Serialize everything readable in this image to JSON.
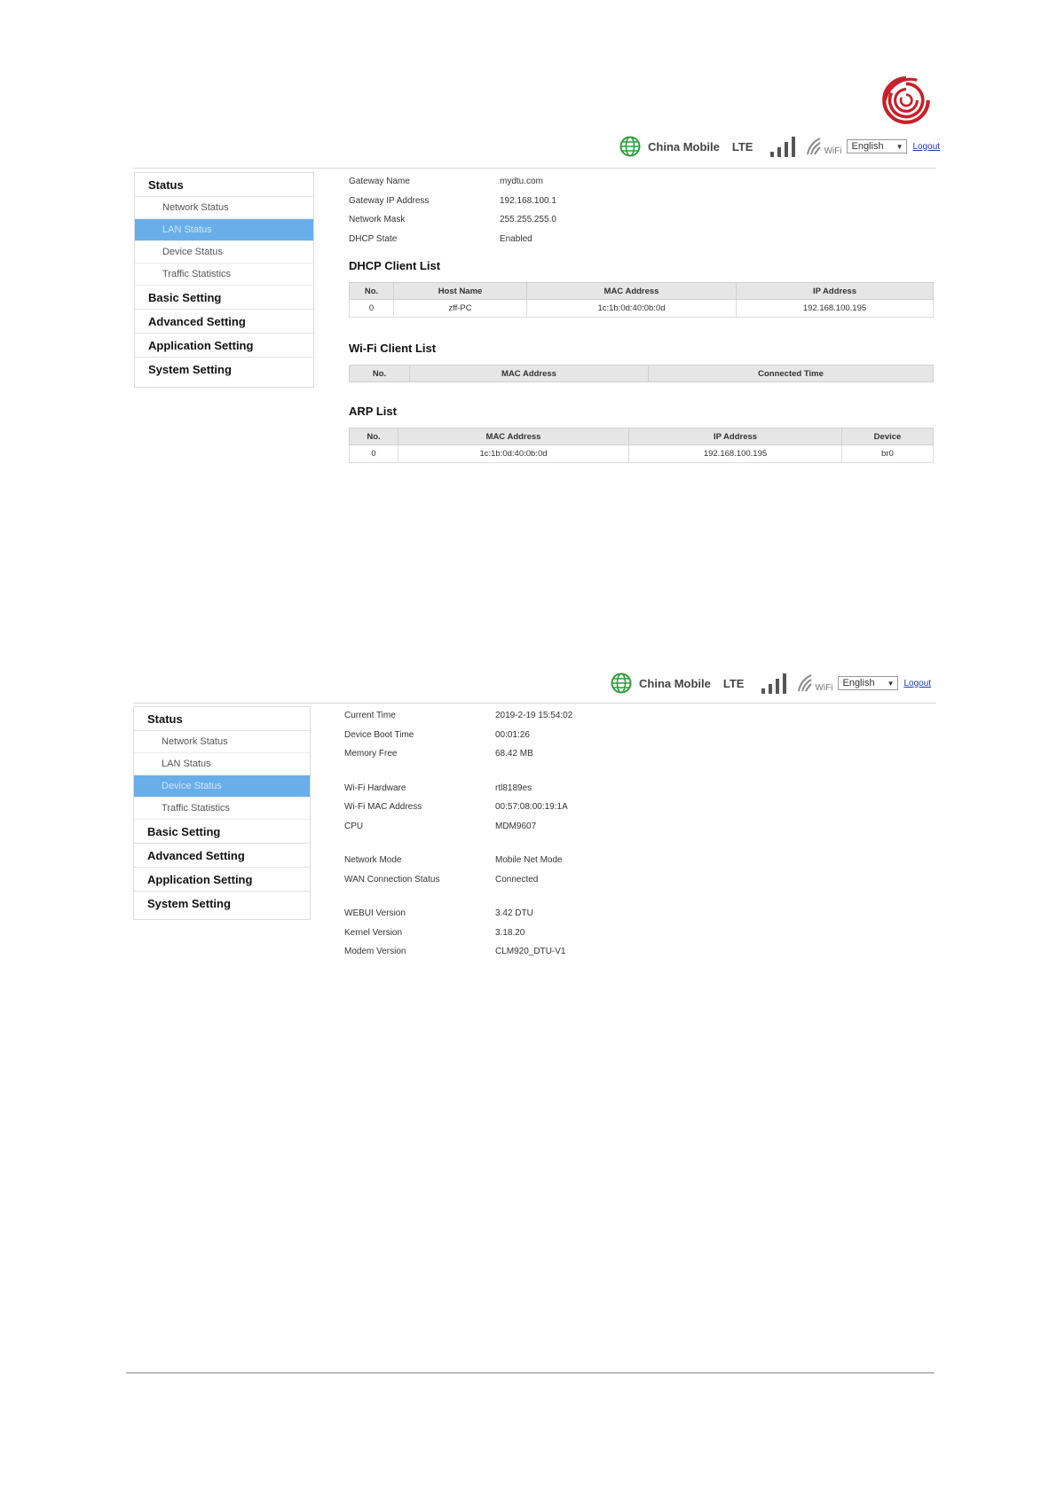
{
  "header": {
    "carrier": "China Mobile",
    "network_type": "LTE",
    "wifi_label": "WiFi",
    "language": "English",
    "logout": "Logout"
  },
  "sidebar1": {
    "status": "Status",
    "network_status": "Network Status",
    "lan_status": "LAN Status",
    "device_status": "Device Status",
    "traffic_statistics": "Traffic Statistics",
    "basic_setting": "Basic Setting",
    "advanced_setting": "Advanced Setting",
    "application_setting": "Application Setting",
    "system_setting": "System Setting",
    "active_item": "LAN Status"
  },
  "sidebar2": {
    "status": "Status",
    "network_status": "Network Status",
    "lan_status": "LAN Status",
    "device_status": "Device Status",
    "traffic_statistics": "Traffic Statistics",
    "basic_setting": "Basic Setting",
    "advanced_setting": "Advanced Setting",
    "application_setting": "Application Setting",
    "system_setting": "System Setting",
    "active_item": "Device Status"
  },
  "lan_info": {
    "gateway_name_label": "Gateway Name",
    "gateway_name": "mydtu.com",
    "gateway_ip_label": "Gateway IP Address",
    "gateway_ip": "192.168.100.1",
    "network_mask_label": "Network Mask",
    "network_mask": "255.255.255.0",
    "dhcp_state_label": "DHCP State",
    "dhcp_state": "Enabled"
  },
  "dhcp": {
    "title": "DHCP Client List",
    "headers": [
      "No.",
      "Host Name",
      "MAC Address",
      "IP Address"
    ],
    "rows": [
      [
        "0",
        "zff-PC",
        "1c:1b:0d:40:0b:0d",
        "192.168.100.195"
      ]
    ]
  },
  "wifi_clients": {
    "title": "Wi-Fi Client List",
    "headers": [
      "No.",
      "MAC Address",
      "Connected Time"
    ]
  },
  "arp": {
    "title": "ARP List",
    "headers": [
      "No.",
      "MAC Address",
      "IP Address",
      "Device"
    ],
    "rows": [
      [
        "0",
        "1c:1b:0d:40:0b:0d",
        "192.168.100.195",
        "br0"
      ]
    ]
  },
  "device_info": {
    "current_time_label": "Current Time",
    "current_time": "2019-2-19 15:54:02",
    "boot_time_label": "Device Boot Time",
    "boot_time": "00:01:26",
    "memory_free_label": "Memory Free",
    "memory_free": "68.42 MB",
    "wifi_hw_label": "Wi-Fi Hardware",
    "wifi_hw": "rtl8189es",
    "wifi_mac_label": "Wi-Fi MAC Address",
    "wifi_mac": "00:57:08:00:19:1A",
    "cpu_label": "CPU",
    "cpu": "MDM9607",
    "network_mode_label": "Network Mode",
    "network_mode": "Mobile Net Mode",
    "wan_status_label": "WAN Connection Status",
    "wan_status": "Connected",
    "webui_label": "WEBUI Version",
    "webui": "3.42 DTU",
    "kernel_label": "Kernel Version",
    "kernel": "3.18.20",
    "modem_label": "Modem Version",
    "modem": "CLM920_DTU-V1"
  },
  "colors": {
    "accent_active": "#69aee8",
    "logo_red": "#c8202a",
    "globe_green": "#2e9e3a",
    "link_blue": "#1a3ba0"
  }
}
